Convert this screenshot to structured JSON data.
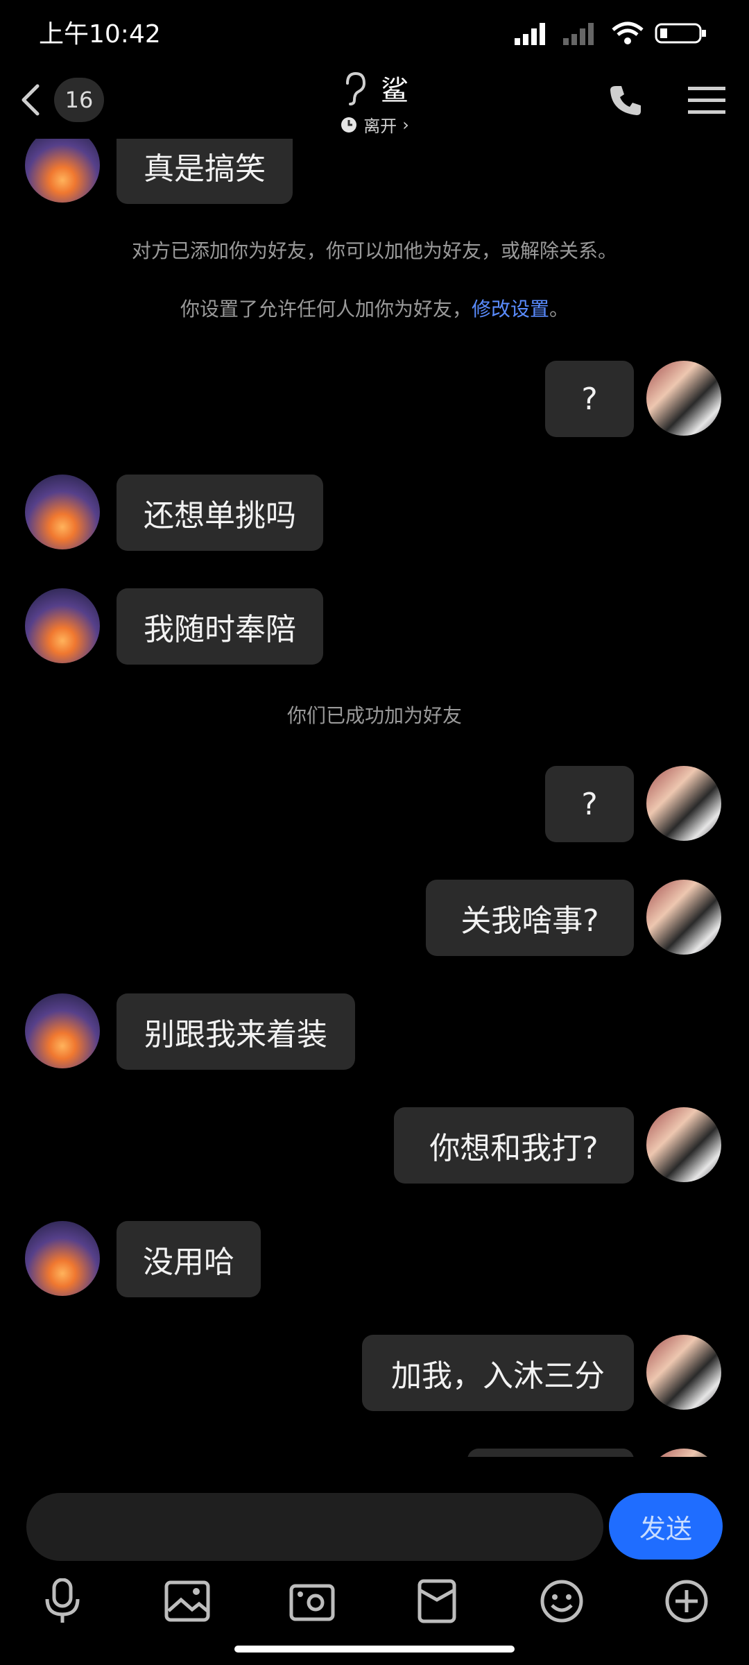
{
  "status": {
    "time": "上午10:42"
  },
  "header": {
    "unread": "16",
    "title": "鲨",
    "subtitle": "离开",
    "subtitle_chevron": "›"
  },
  "system_messages": {
    "added_you": "对方已添加你为好友，你可以加他为好友，或解除关系。",
    "setting_prefix": "你设置了允许任何人加你为好友，",
    "setting_link": "修改设置",
    "setting_suffix": "。",
    "friends_now": "你们已成功加为好友"
  },
  "messages": {
    "m0": "真是搞笑",
    "m1": "?",
    "m2": "还想单挑吗",
    "m3": "我随时奉陪",
    "m4": "?",
    "m5": "关我啥事?",
    "m6": "别跟我来着装",
    "m7": "你想和我打?",
    "m8": "没用哈",
    "m9": "加我，入沐三分"
  },
  "input": {
    "placeholder": "",
    "send_label": "发送"
  },
  "icons": {
    "back": "chevron-left-icon",
    "phone": "phone-icon",
    "menu": "menu-icon",
    "mic": "mic-icon",
    "image": "image-icon",
    "camera": "camera-icon",
    "gift": "red-packet-icon",
    "emoji": "emoji-icon",
    "plus": "plus-icon"
  },
  "colors": {
    "accent": "#1f6dff",
    "bubble": "#2b2b2b",
    "link": "#5a8cff"
  }
}
